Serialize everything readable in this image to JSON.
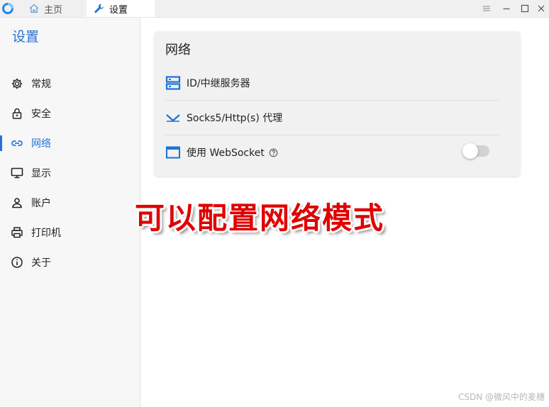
{
  "tabs": [
    {
      "label": "主页",
      "icon": "home-icon"
    },
    {
      "label": "设置",
      "icon": "wrench-icon",
      "active": true
    }
  ],
  "window_controls": [
    "menu-icon",
    "minimize-icon",
    "maximize-icon",
    "close-icon"
  ],
  "sidebar": {
    "title": "设置",
    "items": [
      {
        "label": "常规",
        "icon": "gear-icon"
      },
      {
        "label": "安全",
        "icon": "lock-icon"
      },
      {
        "label": "网络",
        "icon": "link-icon",
        "active": true
      },
      {
        "label": "显示",
        "icon": "monitor-icon"
      },
      {
        "label": "账户",
        "icon": "user-icon"
      },
      {
        "label": "打印机",
        "icon": "printer-icon"
      },
      {
        "label": "关于",
        "icon": "info-icon"
      }
    ]
  },
  "card": {
    "title": "网络",
    "rows": [
      {
        "label": "ID/中继服务器",
        "icon": "server-icon"
      },
      {
        "label": "Socks5/Http(s) 代理",
        "icon": "proxy-icon"
      },
      {
        "label": "使用 WebSocket",
        "icon": "window-icon",
        "help_icon": "help-icon",
        "toggle": false
      }
    ]
  },
  "overlay": {
    "caption": "可以配置网络模式"
  },
  "watermark": "CSDN @微风中的麦穗",
  "colors": {
    "accent": "#2473d6",
    "caption": "#e00000"
  }
}
